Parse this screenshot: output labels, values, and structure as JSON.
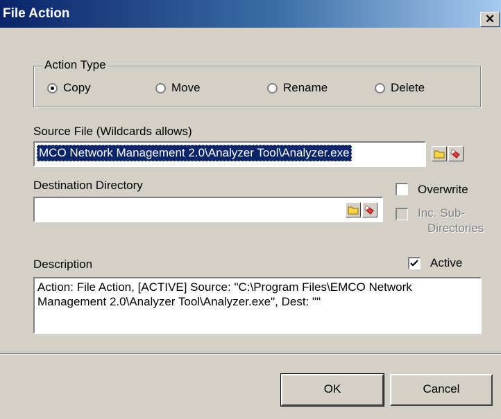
{
  "window": {
    "title": "File Action",
    "close_glyph": "✕"
  },
  "action_type": {
    "legend": "Action Type",
    "options": [
      {
        "label": "Copy",
        "checked": true
      },
      {
        "label": "Move",
        "checked": false
      },
      {
        "label": "Rename",
        "checked": false
      },
      {
        "label": "Delete",
        "checked": false
      }
    ]
  },
  "source": {
    "label": "Source File (Wildcards allows)",
    "value": "MCO Network Management 2.0\\Analyzer Tool\\Analyzer.exe",
    "browse_icon": "folder-icon",
    "clear_icon": "eraser-icon"
  },
  "destination": {
    "label": "Destination Directory",
    "value": "",
    "browse_icon": "folder-icon",
    "clear_icon": "eraser-icon"
  },
  "options": {
    "overwrite": {
      "label": "Overwrite",
      "checked": false
    },
    "inc_sub": {
      "label_line1": "Inc. Sub-",
      "label_line2": "Directories",
      "checked": false,
      "enabled": false
    },
    "active": {
      "label": "Active",
      "checked": true
    }
  },
  "description": {
    "label": "Description",
    "value": "Action: File Action, [ACTIVE] Source: \"C:\\Program Files\\EMCO Network Management 2.0\\Analyzer Tool\\Analyzer.exe\", Dest: \"\""
  },
  "buttons": {
    "ok": "OK",
    "cancel": "Cancel"
  },
  "colors": {
    "title_start": "#0a246a",
    "title_end": "#a6caf0",
    "face": "#d4d0c8",
    "selection": "#0a246a"
  }
}
